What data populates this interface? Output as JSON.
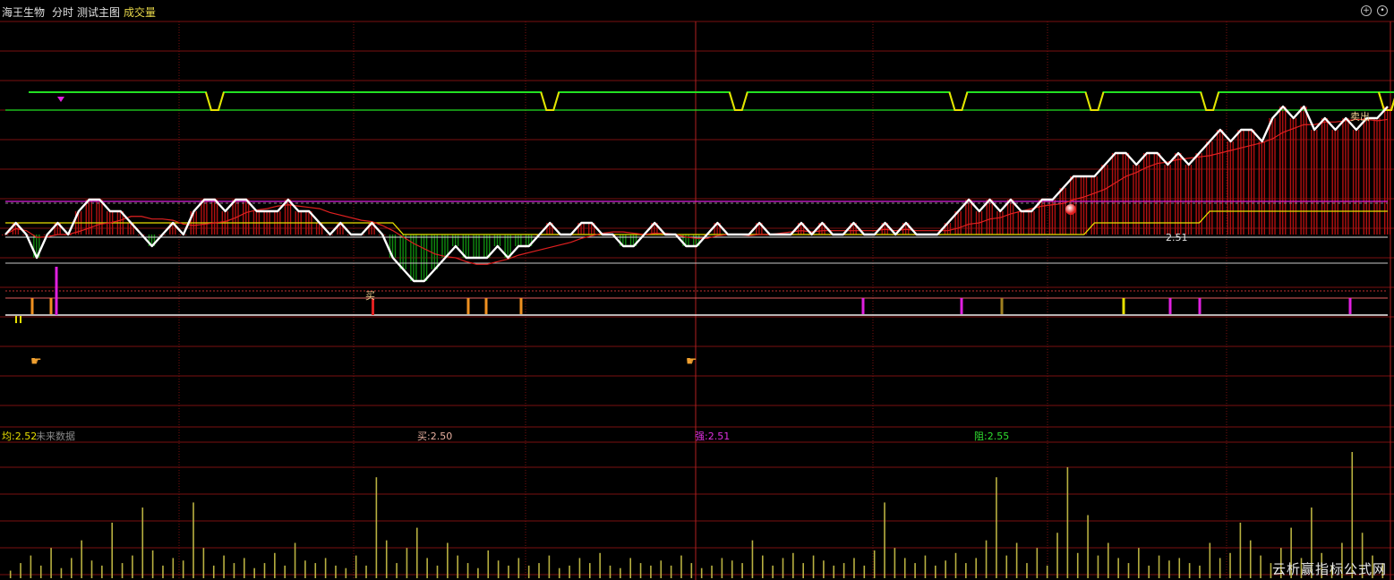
{
  "header": {
    "stock_name": "海王生物",
    "period": "分时",
    "formula": "测试主图",
    "volume_tab": "成交量"
  },
  "footer": {
    "avg_label": "均:2.52",
    "no_data_label": "未来数据",
    "buy_label": "买:2.50",
    "strong_label": "强:2.51",
    "resist_label": "阻:2.55"
  },
  "annotations": {
    "price_label": "2.51",
    "sell_tag": "卖出",
    "buy_tag": "买"
  },
  "watermark": "云析赢指标公式网",
  "colors": {
    "background": "#000000",
    "grid": "#7a1010",
    "price_line": "#ffffff",
    "avg_line": "#e8e000",
    "band_green": "#22e022",
    "band_yellow": "#e8e000",
    "magenta": "#e020e0",
    "up_bar": "#b01010",
    "down_bar": "#0f8a0f",
    "volume": "#b8b040"
  },
  "chart_data": {
    "type": "line",
    "price_series": [
      {
        "name": "price",
        "values": [
          2.52,
          2.53,
          2.52,
          2.5,
          2.52,
          2.53,
          2.52,
          2.54,
          2.55,
          2.55,
          2.54,
          2.54,
          2.53,
          2.52,
          2.51,
          2.52,
          2.53,
          2.52,
          2.54,
          2.55,
          2.55,
          2.54,
          2.55,
          2.55,
          2.54,
          2.54,
          2.54,
          2.55,
          2.54,
          2.54,
          2.53,
          2.52,
          2.53,
          2.52,
          2.52,
          2.53,
          2.52,
          2.5,
          2.49,
          2.48,
          2.48,
          2.49,
          2.5,
          2.51,
          2.5,
          2.5,
          2.5,
          2.51,
          2.5,
          2.51,
          2.51,
          2.52,
          2.53,
          2.52,
          2.52,
          2.53,
          2.53,
          2.52,
          2.52,
          2.51,
          2.51,
          2.52,
          2.53,
          2.52,
          2.52,
          2.51,
          2.51,
          2.52,
          2.53,
          2.52,
          2.52,
          2.52,
          2.53,
          2.52,
          2.52,
          2.52,
          2.53,
          2.52,
          2.53,
          2.52,
          2.52,
          2.53,
          2.52,
          2.52,
          2.53,
          2.52,
          2.53,
          2.52,
          2.52,
          2.52,
          2.53,
          2.54,
          2.55,
          2.54,
          2.55,
          2.54,
          2.55,
          2.54,
          2.54,
          2.55,
          2.55,
          2.56,
          2.57,
          2.57,
          2.57,
          2.58,
          2.59,
          2.59,
          2.58,
          2.59,
          2.59,
          2.58,
          2.59,
          2.58,
          2.59,
          2.6,
          2.61,
          2.6,
          2.61,
          2.61,
          2.6,
          2.62,
          2.63,
          2.62,
          2.63,
          2.61,
          2.62,
          2.61,
          2.62,
          2.61,
          2.62,
          2.62,
          2.63
        ]
      },
      {
        "name": "avg",
        "values": [
          2.53,
          2.53,
          2.53,
          2.53,
          2.53,
          2.53,
          2.53,
          2.53,
          2.53,
          2.53,
          2.53,
          2.53,
          2.53,
          2.53,
          2.53,
          2.53,
          2.53,
          2.53,
          2.53,
          2.53,
          2.53,
          2.53,
          2.53,
          2.53,
          2.53,
          2.53,
          2.53,
          2.53,
          2.53,
          2.53,
          2.53,
          2.53,
          2.53,
          2.53,
          2.53,
          2.53,
          2.53,
          2.53,
          2.52,
          2.52,
          2.52,
          2.52,
          2.52,
          2.52,
          2.52,
          2.52,
          2.52,
          2.52,
          2.52,
          2.52,
          2.52,
          2.52,
          2.52,
          2.52,
          2.52,
          2.52,
          2.52,
          2.52,
          2.52,
          2.52,
          2.52,
          2.52,
          2.52,
          2.52,
          2.52,
          2.52,
          2.52,
          2.52,
          2.52,
          2.52,
          2.52,
          2.52,
          2.52,
          2.52,
          2.52,
          2.52,
          2.52,
          2.52,
          2.52,
          2.52,
          2.52,
          2.52,
          2.52,
          2.52,
          2.52,
          2.52,
          2.52,
          2.52,
          2.52,
          2.52,
          2.52,
          2.52,
          2.52,
          2.52,
          2.52,
          2.52,
          2.52,
          2.52,
          2.52,
          2.52,
          2.52,
          2.52,
          2.52,
          2.52,
          2.53,
          2.53,
          2.53,
          2.53,
          2.53,
          2.53,
          2.53,
          2.53,
          2.53,
          2.53,
          2.53,
          2.54,
          2.54,
          2.54,
          2.54,
          2.54,
          2.54,
          2.54,
          2.54,
          2.54,
          2.54,
          2.54,
          2.54,
          2.54,
          2.54,
          2.54,
          2.54,
          2.54,
          2.54
        ]
      }
    ],
    "band_top": 2.62,
    "band_bottom": 2.6,
    "band_dips": [
      20,
      52,
      70,
      91,
      104,
      115,
      133,
      146
    ],
    "volume": [
      3,
      6,
      9,
      5,
      12,
      4,
      8,
      15,
      7,
      5,
      22,
      6,
      9,
      28,
      11,
      5,
      8,
      7,
      30,
      12,
      5,
      9,
      6,
      8,
      4,
      6,
      10,
      5,
      14,
      7,
      6,
      8,
      5,
      4,
      9,
      5,
      40,
      15,
      6,
      12,
      20,
      8,
      5,
      14,
      9,
      6,
      4,
      11,
      7,
      5,
      8,
      5,
      6,
      9,
      4,
      5,
      8,
      6,
      10,
      5,
      4,
      8,
      6,
      5,
      7,
      5,
      9,
      6,
      4,
      5,
      8,
      7,
      6,
      15,
      9,
      5,
      8,
      10,
      6,
      9,
      7,
      5,
      6,
      8,
      5,
      11,
      30,
      12,
      8,
      6,
      9,
      5,
      7,
      10,
      6,
      8,
      15,
      40,
      9,
      14,
      6,
      12,
      5,
      18,
      44,
      10,
      25,
      9,
      14,
      8,
      6,
      12,
      5,
      9,
      7,
      8,
      6,
      5,
      14,
      8,
      10,
      22,
      15,
      9,
      6,
      12,
      20,
      8,
      28,
      10,
      5,
      14,
      50,
      18,
      9,
      6
    ],
    "avg_price": 2.52,
    "buy_level": 2.5,
    "strong_level": 2.51,
    "resist_level": 2.55
  }
}
